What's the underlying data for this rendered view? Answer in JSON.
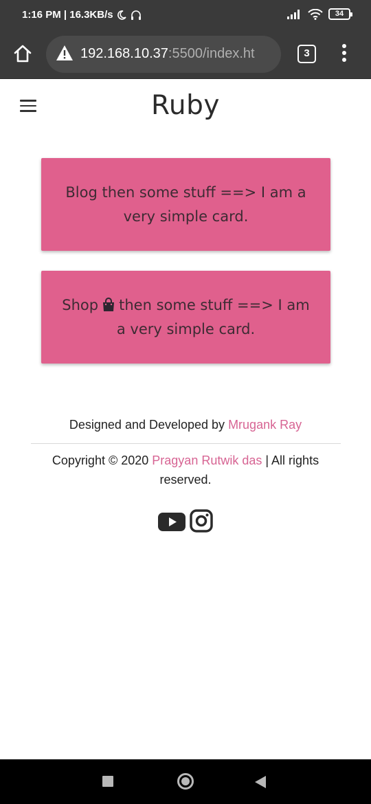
{
  "status_bar": {
    "time_info": "1:16 PM | 16.3KB/s",
    "battery": "34"
  },
  "browser": {
    "url_host": "192.168.10.37",
    "url_rest": ":5500/index.ht",
    "tab_count": "3"
  },
  "page": {
    "brand": "Ruby",
    "cards": [
      {
        "text": "Blog then some stuff ==> I am a very simple card."
      },
      {
        "text_before_icon": "Shop",
        "text_after_icon": "then some stuff ==> I am a very simple card."
      }
    ],
    "footer": {
      "designed_prefix": "Designed and Developed by ",
      "designer_name": "Mrugank Ray",
      "copyright_prefix": "Copyright © 2020 ",
      "copyright_name": "Pragyan Rutwik das",
      "copyright_suffix": " | All rights reserved."
    }
  },
  "colors": {
    "card_bg": "#e0608d",
    "link_pink": "#d76493",
    "chrome_bg": "#3a3a3a"
  },
  "icons": [
    "moon-icon",
    "headphones-icon",
    "signal-icon",
    "wifi-icon",
    "battery-icon",
    "home-icon",
    "warning-icon",
    "tabs-icon",
    "more-icon",
    "hamburger-icon",
    "shopping-bag-icon",
    "youtube-icon",
    "instagram-icon"
  ]
}
